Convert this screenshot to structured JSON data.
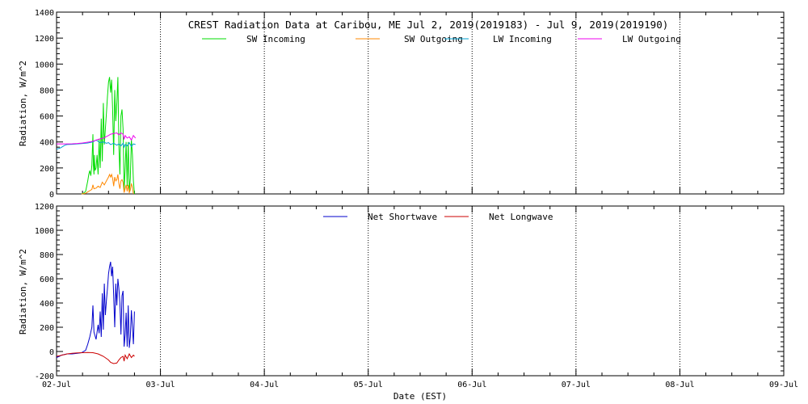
{
  "chart_data": [
    {
      "type": "line",
      "title": "CREST Radiation Data at Caribou, ME   Jul  2, 2019(2019183) - Jul  9, 2019(2019190)",
      "xlabel": "",
      "ylabel": "Radiation, W/m^2",
      "xlim": [
        "02-Jul",
        "09-Jul"
      ],
      "ylim": [
        0,
        1400
      ],
      "yticks": [
        0,
        200,
        400,
        600,
        800,
        1000,
        1200,
        1400
      ],
      "grid": true,
      "legend_position": "top",
      "series": [
        {
          "name": "SW Incoming",
          "color": "#00dd00",
          "x": [
            0.24,
            0.26,
            0.28,
            0.29,
            0.3,
            0.31,
            0.32,
            0.33,
            0.34,
            0.35,
            0.355,
            0.36,
            0.365,
            0.37,
            0.38,
            0.39,
            0.4,
            0.41,
            0.42,
            0.43,
            0.44,
            0.45,
            0.46,
            0.47,
            0.48,
            0.49,
            0.5,
            0.51,
            0.52,
            0.53,
            0.54,
            0.55,
            0.56,
            0.57,
            0.58,
            0.59,
            0.6,
            0.61,
            0.62,
            0.63,
            0.64,
            0.65,
            0.66,
            0.67,
            0.68,
            0.69,
            0.7,
            0.71,
            0.72,
            0.73,
            0.74,
            0.75
          ],
          "y": [
            0,
            5,
            20,
            60,
            100,
            150,
            180,
            140,
            220,
            460,
            220,
            150,
            300,
            180,
            200,
            300,
            150,
            420,
            200,
            580,
            250,
            700,
            380,
            500,
            620,
            750,
            860,
            900,
            780,
            880,
            650,
            300,
            800,
            560,
            700,
            900,
            380,
            150,
            600,
            650,
            500,
            30,
            200,
            400,
            60,
            400,
            20,
            120,
            420,
            300,
            100,
            0
          ]
        },
        {
          "name": "SW Outgoing",
          "color": "#ff8800",
          "x": [
            0.24,
            0.26,
            0.28,
            0.3,
            0.32,
            0.34,
            0.35,
            0.36,
            0.38,
            0.4,
            0.42,
            0.44,
            0.46,
            0.48,
            0.5,
            0.51,
            0.52,
            0.53,
            0.54,
            0.55,
            0.56,
            0.57,
            0.58,
            0.59,
            0.6,
            0.61,
            0.62,
            0.63,
            0.64,
            0.65,
            0.66,
            0.67,
            0.68,
            0.69,
            0.7,
            0.71,
            0.72,
            0.73,
            0.74
          ],
          "y": [
            0,
            2,
            5,
            15,
            25,
            35,
            70,
            40,
            45,
            60,
            50,
            90,
            70,
            100,
            130,
            150,
            130,
            150,
            120,
            60,
            130,
            100,
            110,
            150,
            80,
            40,
            100,
            110,
            90,
            10,
            40,
            70,
            20,
            70,
            10,
            30,
            80,
            50,
            0
          ]
        },
        {
          "name": "LW Incoming",
          "color": "#00a0d0",
          "x": [
            0.0,
            0.02,
            0.04,
            0.06,
            0.08,
            0.1,
            0.15,
            0.2,
            0.25,
            0.3,
            0.35,
            0.38,
            0.4,
            0.42,
            0.45,
            0.48,
            0.5,
            0.52,
            0.55,
            0.58,
            0.6,
            0.62,
            0.64,
            0.65,
            0.66,
            0.68,
            0.7,
            0.72,
            0.74,
            0.76
          ],
          "y": [
            345,
            350,
            355,
            365,
            375,
            380,
            382,
            385,
            388,
            392,
            400,
            415,
            405,
            395,
            400,
            390,
            395,
            380,
            390,
            375,
            385,
            370,
            390,
            360,
            380,
            370,
            395,
            365,
            385,
            380
          ]
        },
        {
          "name": "LW Outgoing",
          "color": "#ee00ee",
          "x": [
            0.0,
            0.05,
            0.1,
            0.15,
            0.2,
            0.25,
            0.3,
            0.35,
            0.4,
            0.45,
            0.5,
            0.52,
            0.55,
            0.58,
            0.6,
            0.62,
            0.64,
            0.65,
            0.66,
            0.68,
            0.7,
            0.72,
            0.74,
            0.76
          ],
          "y": [
            385,
            385,
            385,
            386,
            388,
            392,
            398,
            405,
            420,
            430,
            450,
            460,
            465,
            470,
            455,
            470,
            460,
            420,
            450,
            430,
            440,
            415,
            450,
            430
          ]
        }
      ]
    },
    {
      "type": "line",
      "title": "",
      "xlabel": "Date (EST)",
      "ylabel": "Radiation, W/m^2",
      "xlim": [
        "02-Jul",
        "09-Jul"
      ],
      "xticks": [
        "02-Jul",
        "03-Jul",
        "04-Jul",
        "05-Jul",
        "06-Jul",
        "07-Jul",
        "08-Jul",
        "09-Jul"
      ],
      "ylim": [
        -200,
        1200
      ],
      "yticks": [
        -200,
        0,
        200,
        400,
        600,
        800,
        1000,
        1200
      ],
      "grid": true,
      "legend_position": "top",
      "series": [
        {
          "name": "Net Shortwave",
          "color": "#0000cc",
          "x": [
            0.0,
            0.05,
            0.1,
            0.15,
            0.2,
            0.24,
            0.28,
            0.3,
            0.32,
            0.34,
            0.35,
            0.36,
            0.38,
            0.4,
            0.41,
            0.42,
            0.43,
            0.44,
            0.45,
            0.46,
            0.47,
            0.48,
            0.49,
            0.5,
            0.51,
            0.52,
            0.53,
            0.54,
            0.55,
            0.56,
            0.57,
            0.58,
            0.59,
            0.6,
            0.61,
            0.62,
            0.63,
            0.64,
            0.65,
            0.66,
            0.67,
            0.68,
            0.69,
            0.7,
            0.71,
            0.72,
            0.73,
            0.74,
            0.75
          ],
          "y": [
            -50,
            -30,
            -20,
            -20,
            -15,
            -10,
            10,
            60,
            120,
            200,
            380,
            160,
            100,
            220,
            150,
            330,
            120,
            480,
            180,
            560,
            300,
            420,
            520,
            640,
            700,
            740,
            620,
            700,
            460,
            200,
            560,
            380,
            600,
            520,
            400,
            140,
            460,
            500,
            40,
            140,
            320,
            40,
            380,
            30,
            120,
            340,
            200,
            60,
            330
          ]
        },
        {
          "name": "Net Longwave",
          "color": "#cc0000",
          "x": [
            0.0,
            0.03,
            0.05,
            0.08,
            0.1,
            0.15,
            0.2,
            0.25,
            0.3,
            0.35,
            0.4,
            0.45,
            0.5,
            0.52,
            0.55,
            0.58,
            0.6,
            0.62,
            0.64,
            0.65,
            0.66,
            0.68,
            0.7,
            0.72,
            0.74,
            0.75
          ],
          "y": [
            -40,
            -35,
            -30,
            -25,
            -20,
            -15,
            -12,
            -10,
            -8,
            -10,
            -20,
            -40,
            -70,
            -90,
            -100,
            -95,
            -70,
            -50,
            -40,
            -80,
            -30,
            -60,
            -20,
            -50,
            -30,
            -40
          ]
        }
      ]
    }
  ]
}
